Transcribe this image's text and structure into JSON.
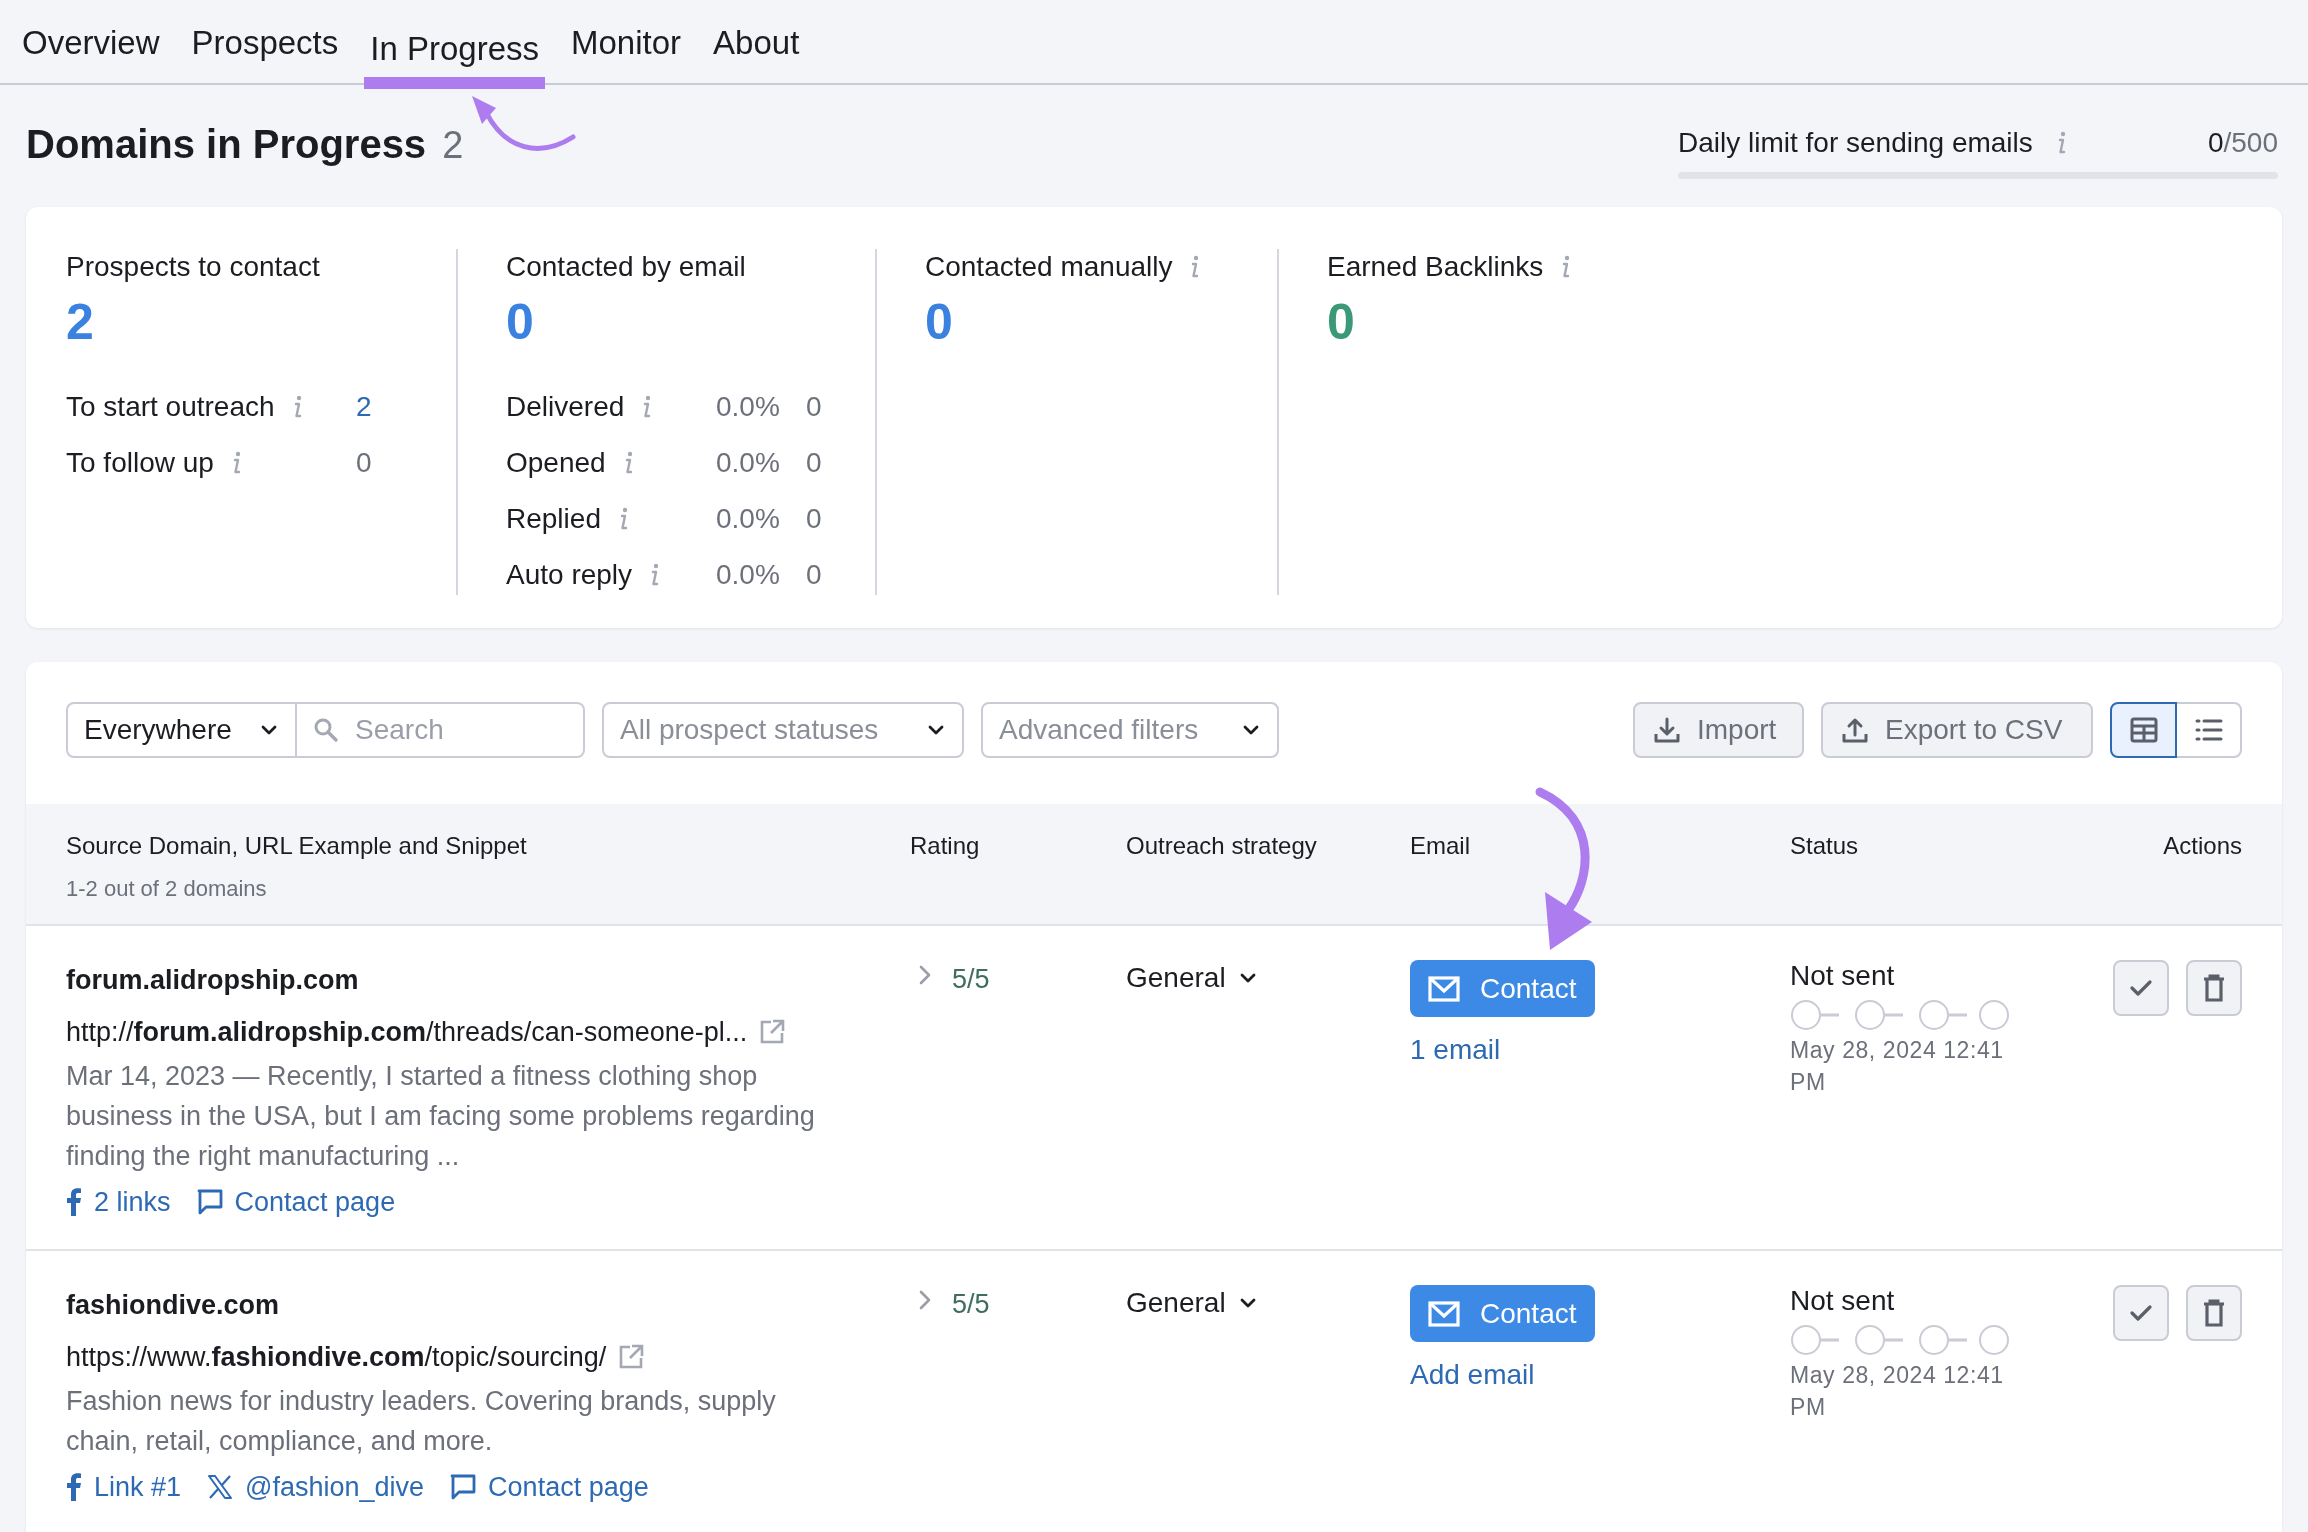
{
  "nav": {
    "tabs": [
      {
        "label": "Overview",
        "selected": false
      },
      {
        "label": "Prospects",
        "selected": false
      },
      {
        "label": "In Progress",
        "selected": true
      },
      {
        "label": "Monitor",
        "selected": false
      },
      {
        "label": "About",
        "selected": false
      }
    ]
  },
  "header": {
    "title": "Domains in Progress",
    "count": "2",
    "daily_limit": {
      "label": "Daily limit for sending emails",
      "info": true,
      "used": "0",
      "total": "/500",
      "level": 0
    }
  },
  "stats": [
    {
      "label": "Prospects to contact",
      "value": "2",
      "color": "#3b82e0",
      "rows": [
        {
          "label": "To start outreach",
          "info": true,
          "count": "2",
          "link": true
        },
        {
          "label": "To follow up",
          "info": true,
          "count": "0",
          "link": false
        }
      ]
    },
    {
      "label": "Contacted by email",
      "value": "0",
      "color": "#3b82e0",
      "rows": [
        {
          "label": "Delivered",
          "info": true,
          "percent": "0.0%",
          "count": "0",
          "link": false
        },
        {
          "label": "Opened",
          "info": true,
          "percent": "0.0%",
          "count": "0",
          "link": false
        },
        {
          "label": "Replied",
          "info": true,
          "percent": "0.0%",
          "count": "0",
          "link": false
        },
        {
          "label": "Auto reply",
          "info": true,
          "percent": "0.0%",
          "count": "0",
          "link": false
        }
      ]
    },
    {
      "label": "Contacted manually",
      "info": true,
      "value": "0",
      "color": "#3b82e0"
    },
    {
      "label": "Earned Backlinks",
      "info": true,
      "value": "0",
      "color": "#3a9a78"
    }
  ],
  "filters": {
    "location": "Everywhere",
    "search": {
      "placeholder": "Search"
    },
    "statuses": "All prospect statuses",
    "advanced": "Advanced filters",
    "import": "Import",
    "export": "Export to CSV",
    "views": [
      {
        "kind": "table",
        "selected": true
      },
      {
        "kind": "list",
        "selected": false
      }
    ]
  },
  "table": {
    "columns": [
      {
        "label": "Source Domain, URL Example and Snippet",
        "subtitle": "1-2 out of 2 domains"
      },
      {
        "label": "Rating"
      },
      {
        "label": "Outreach strategy"
      },
      {
        "label": "Email"
      },
      {
        "label": "Status"
      },
      {
        "label": "Actions"
      }
    ],
    "rows": [
      {
        "domain": "forum.alidropship.com",
        "url": "http://**forum.alidropship.com**/threads/can-someone-pl...",
        "snippet": "Mar 14, 2023 — Recently, I started a fitness clothing shop business in the USA, but I am facing some problems regarding finding the right manufacturing ...",
        "links": [
          {
            "kind": "facebook",
            "label": "2 links"
          },
          {
            "kind": "contact",
            "label": "Contact page"
          }
        ],
        "rating": "5/5",
        "strategy": "General",
        "contact": "Contact",
        "email_link": "1 email",
        "status": "Not sent",
        "date": "May 28, 2024 12:41 PM"
      },
      {
        "domain": "fashiondive.com",
        "url": "https://www.**fashiondive.com**/topic/sourcing/",
        "snippet": "Fashion news for industry leaders. Covering brands, supply chain, retail, compliance, and more.",
        "links": [
          {
            "kind": "facebook",
            "label": "Link #1"
          },
          {
            "kind": "x",
            "label": "@fashion_dive"
          },
          {
            "kind": "contact",
            "label": "Contact page"
          }
        ],
        "rating": "5/5",
        "strategy": "General",
        "contact": "Contact",
        "email_link": "Add email",
        "status": "Not sent",
        "date": "May 28, 2024 12:41 PM"
      }
    ]
  }
}
